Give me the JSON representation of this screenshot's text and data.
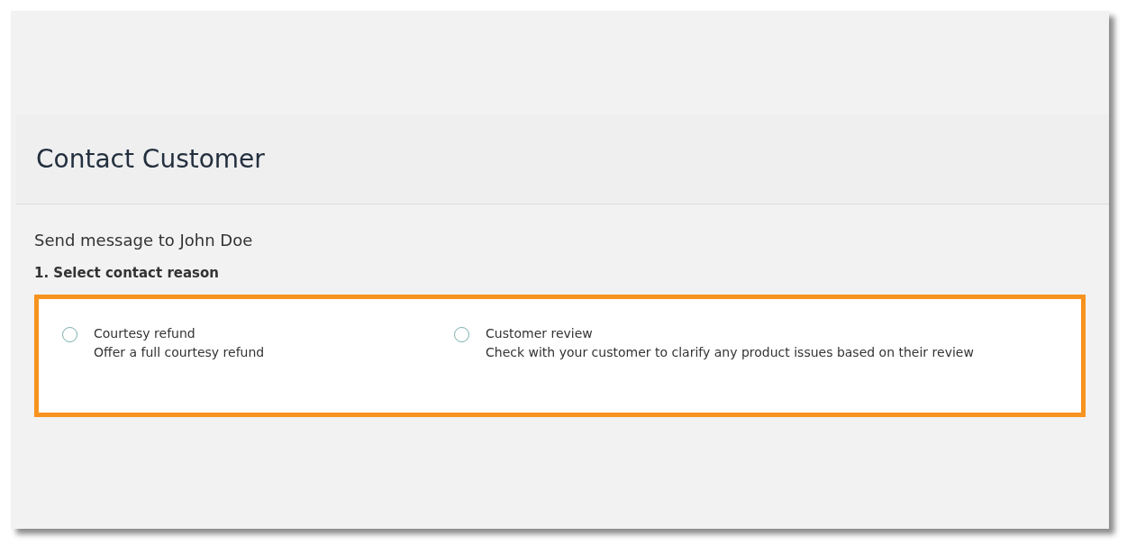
{
  "dialog": {
    "title": "Contact Customer"
  },
  "recipient": "Send message to John Doe",
  "step": {
    "label": "1. Select contact reason",
    "highlighted": true
  },
  "options": [
    {
      "title": "Courtesy refund",
      "description": "Offer a full courtesy refund",
      "selected": false
    },
    {
      "title": "Customer review",
      "description": "Check with your customer to clarify any product issues based on their review",
      "selected": false
    }
  ]
}
